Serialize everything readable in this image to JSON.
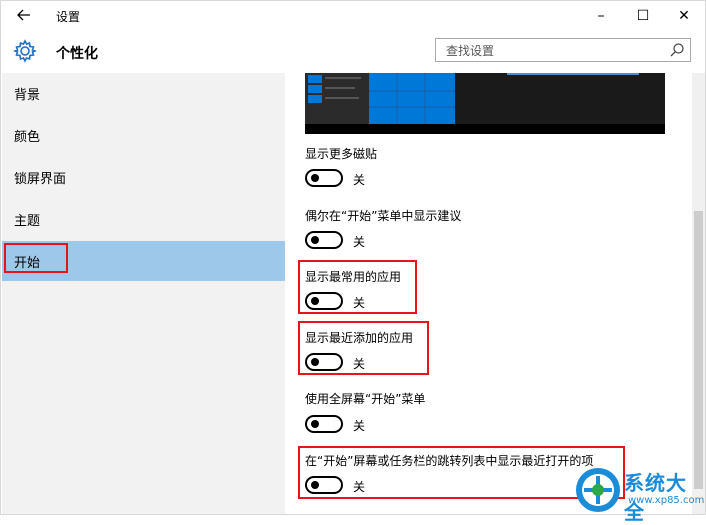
{
  "window": {
    "title": "设置",
    "back_icon": "back-arrow-icon",
    "controls": {
      "minimize": "–",
      "maximize": "☐",
      "close": "✕"
    }
  },
  "header": {
    "title": "个性化",
    "icon": "gear-icon",
    "search_placeholder": "查找设置"
  },
  "sidebar": {
    "items": [
      {
        "label": "背景",
        "selected": false
      },
      {
        "label": "颜色",
        "selected": false
      },
      {
        "label": "锁屏界面",
        "selected": false
      },
      {
        "label": "主题",
        "selected": false
      },
      {
        "label": "开始",
        "selected": true
      }
    ]
  },
  "settings": [
    {
      "label": "显示更多磁贴",
      "state": "关",
      "on": false
    },
    {
      "label": "偶尔在“开始”菜单中显示建议",
      "state": "关",
      "on": false
    },
    {
      "label": "显示最常用的应用",
      "state": "关",
      "on": false
    },
    {
      "label": "显示最近添加的应用",
      "state": "关",
      "on": false
    },
    {
      "label": "使用全屏幕“开始”菜单",
      "state": "关",
      "on": false
    },
    {
      "label": "在“开始”屏幕或任务栏的跳转列表中显示最近打开的项",
      "state": "关",
      "on": false
    }
  ],
  "watermark": {
    "text": "系统大全",
    "url": "www.xp85.com"
  },
  "colors": {
    "accent": "#9ec8ea",
    "highlight_box": "#e8141c",
    "tile_blue": "#0078d7"
  }
}
